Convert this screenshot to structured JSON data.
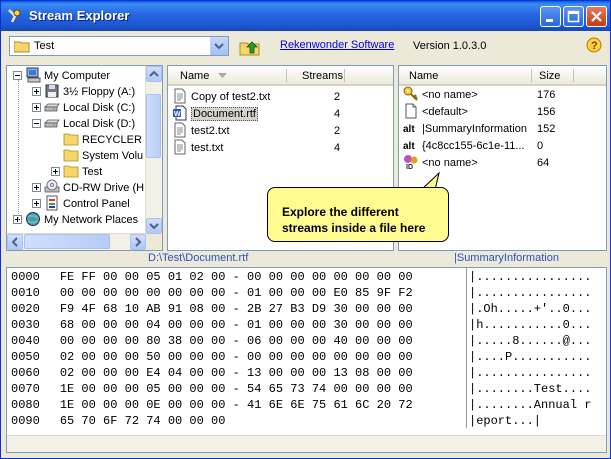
{
  "window": {
    "title": "Stream Explorer"
  },
  "toolbar": {
    "location": "Test",
    "link": "Rekenwonder Software",
    "version": "Version 1.0.3.0"
  },
  "tree": {
    "items": [
      {
        "label": "My Computer",
        "icon": "computer-icon",
        "indent": 0,
        "expander": "-"
      },
      {
        "label": "3½ Floppy (A:)",
        "icon": "floppy-icon",
        "indent": 1,
        "expander": "+"
      },
      {
        "label": "Local Disk (C:)",
        "icon": "drive-icon",
        "indent": 1,
        "expander": "+"
      },
      {
        "label": "Local Disk (D:)",
        "icon": "drive-icon",
        "indent": 1,
        "expander": "-"
      },
      {
        "label": "RECYCLER",
        "icon": "folder-icon",
        "indent": 2,
        "expander": ""
      },
      {
        "label": "System Volu",
        "icon": "folder-icon",
        "indent": 2,
        "expander": ""
      },
      {
        "label": "Test",
        "icon": "folder-icon",
        "indent": 2,
        "expander": "+"
      },
      {
        "label": "CD-RW Drive (H",
        "icon": "cdrom-icon",
        "indent": 1,
        "expander": "+"
      },
      {
        "label": "Control Panel",
        "icon": "control-panel-icon",
        "indent": 1,
        "expander": "+"
      },
      {
        "label": "My Network Places",
        "icon": "network-icon",
        "indent": 0,
        "expander": "+"
      }
    ]
  },
  "files": {
    "headers": {
      "name": "Name",
      "streams": "Streams"
    },
    "rows": [
      {
        "name": "Copy of test2.txt",
        "streams": "2",
        "icon": "text-file-icon",
        "selected": false
      },
      {
        "name": "Document.rtf",
        "streams": "4",
        "icon": "word-document-icon",
        "selected": true
      },
      {
        "name": "test2.txt",
        "streams": "2",
        "icon": "text-file-icon",
        "selected": false
      },
      {
        "name": "test.txt",
        "streams": "4",
        "icon": "text-file-icon",
        "selected": false
      }
    ]
  },
  "streams": {
    "headers": {
      "name": "Name",
      "size": "Size"
    },
    "rows": [
      {
        "name": "<no name>",
        "size": "176",
        "icon": "key-icon"
      },
      {
        "name": "<default>",
        "size": "156",
        "icon": "document-icon"
      },
      {
        "name": "|SummaryInformation",
        "size": "152",
        "icon": "alt-stream-icon"
      },
      {
        "name": "{4c8cc155-6c1e-11...",
        "size": "0",
        "icon": "alt-stream-icon"
      },
      {
        "name": "<no name>",
        "size": "64",
        "icon": "object-id-icon"
      }
    ]
  },
  "callout": {
    "line1": "Explore the different",
    "line2": "streams inside a file here"
  },
  "paths": {
    "file": "D:\\Test\\Document.rtf",
    "stream": "|SummaryInformation"
  },
  "hex": {
    "rows": [
      {
        "offset": "0000",
        "bytes": "FE FF 00 00 05 01 02 00 - 00 00 00 00 00 00 00 00",
        "ascii": "|................"
      },
      {
        "offset": "0010",
        "bytes": "00 00 00 00 00 00 00 00 - 01 00 00 00 E0 85 9F F2",
        "ascii": "|................"
      },
      {
        "offset": "0020",
        "bytes": "F9 4F 68 10 AB 91 08 00 - 2B 27 B3 D9 30 00 00 00",
        "ascii": "|.Oh.....+'..0..."
      },
      {
        "offset": "0030",
        "bytes": "68 00 00 00 04 00 00 00 - 01 00 00 00 30 00 00 00",
        "ascii": "|h...........0..."
      },
      {
        "offset": "0040",
        "bytes": "00 00 00 00 80 38 00 00 - 06 00 00 00 40 00 00 00",
        "ascii": "|.....8......@..."
      },
      {
        "offset": "0050",
        "bytes": "02 00 00 00 50 00 00 00 - 00 00 00 00 00 00 00 00",
        "ascii": "|....P..........."
      },
      {
        "offset": "0060",
        "bytes": "02 00 00 00 E4 04 00 00 - 13 00 00 00 13 08 00 00",
        "ascii": "|................"
      },
      {
        "offset": "0070",
        "bytes": "1E 00 00 00 05 00 00 00 - 54 65 73 74 00 00 00 00",
        "ascii": "|........Test...."
      },
      {
        "offset": "0080",
        "bytes": "1E 00 00 00 0E 00 00 00 - 41 6E 6E 75 61 6C 20 72",
        "ascii": "|........Annual r"
      },
      {
        "offset": "0090",
        "bytes": "65 70 6F 72 74 00 00 00",
        "ascii": "|eport...|"
      }
    ]
  }
}
